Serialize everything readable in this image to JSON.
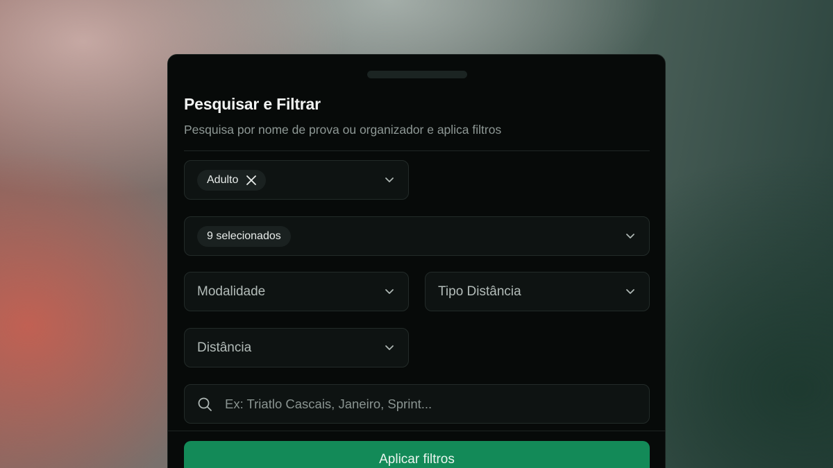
{
  "sheet": {
    "title": "Pesquisar e Filtrar",
    "subtitle": "Pesquisa por nome de prova ou organizador e aplica filtros"
  },
  "filters": {
    "age_group": {
      "chip_label": "Adulto"
    },
    "categories": {
      "chip_label": "9 selecionados"
    },
    "modality": {
      "placeholder": "Modalidade"
    },
    "distance_type": {
      "placeholder": "Tipo Distância"
    },
    "distance": {
      "placeholder": "Distância"
    }
  },
  "search": {
    "placeholder": "Ex: Triatlo Cascais, Janeiro, Sprint..."
  },
  "actions": {
    "apply_label": "Aplicar filtros"
  },
  "colors": {
    "accent": "#138a58",
    "sheet_bg": "#070a09"
  },
  "icons": [
    "chevron-down-icon",
    "close-icon",
    "search-icon"
  ]
}
